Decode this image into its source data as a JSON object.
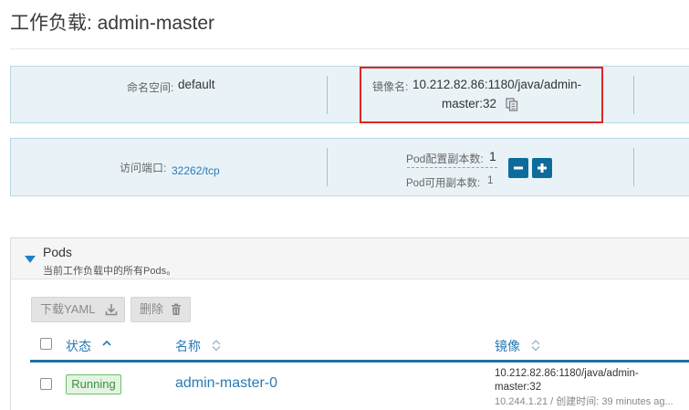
{
  "page": {
    "title": "工作负载: admin-master"
  },
  "info": {
    "namespace_label": "命名空间:",
    "namespace_value": "default",
    "image_label": "镜像名:",
    "image_value_line1": "10.212.82.86:1180/java/admin-",
    "image_value_line2": "master:32",
    "port_label": "访问端口:",
    "port_value": "32262/tcp",
    "replicas_label": "Pod配置副本数:",
    "replicas_value": "1",
    "available_label": "Pod可用副本数:",
    "available_value": "1"
  },
  "pods": {
    "title": "Pods",
    "subtitle": "当前工作负载中的所有Pods。",
    "download_label": "下载YAML",
    "delete_label": "删除",
    "columns": {
      "status": "状态",
      "name": "名称",
      "image": "镜像"
    },
    "rows": [
      {
        "status": "Running",
        "name": "admin-master-0",
        "image_line1": "10.212.82.86:1180/java/admin-",
        "image_line2": "master:32",
        "meta": "10.244.1.21 / 创建时间: 39 minutes ag..."
      }
    ]
  },
  "icons": [
    "copy-icon",
    "minus-icon",
    "plus-icon",
    "download-icon",
    "trash-icon",
    "sort-icon",
    "collapse-triangle-icon"
  ],
  "colors": {
    "accent": "#0e6c9c",
    "link": "#2a7ab6",
    "highlight_border": "#e02525",
    "status_running": "#3f8f3f"
  }
}
